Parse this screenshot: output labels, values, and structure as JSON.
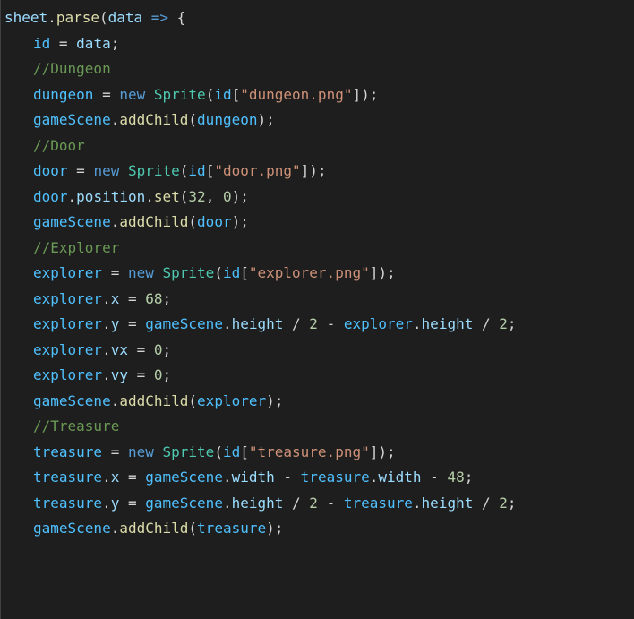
{
  "code": {
    "l1": {
      "obj": "sheet",
      "d1": ".",
      "fn": "parse",
      "p1": "(",
      "arg": "data",
      "arrow": " => ",
      "b1": "{"
    },
    "l2": {
      "v": "id",
      "eq": " = ",
      "rhs": "data",
      "sc": ";"
    },
    "l3": {
      "cmt": "//Dungeon"
    },
    "l4": {
      "v": "dungeon",
      "eq": " = ",
      "kw": "new",
      "sp": " ",
      "cls": "Sprite",
      "p1": "(",
      "v2": "id",
      "br1": "[",
      "s": "\"dungeon.png\"",
      "br2": "]);"
    },
    "l5": {
      "v": "gameScene",
      "d": ".",
      "fn": "addChild",
      "p1": "(",
      "arg": "dungeon",
      "p2": ");"
    },
    "l6": {
      "blank": ""
    },
    "l7": {
      "cmt": "//Door"
    },
    "l8": {
      "v": "door",
      "eq": " = ",
      "kw": "new",
      "sp": " ",
      "cls": "Sprite",
      "p1": "(",
      "v2": "id",
      "br1": "[",
      "s": "\"door.png\"",
      "br2": "]);"
    },
    "l9": {
      "v": "door",
      "d": ".",
      "p": "position",
      "d2": ".",
      "fn": "set",
      "p1": "(",
      "n1": "32",
      "c": ", ",
      "n2": "0",
      "p2": ");"
    },
    "l10": {
      "v": "gameScene",
      "d": ".",
      "fn": "addChild",
      "p1": "(",
      "arg": "door",
      "p2": ");"
    },
    "l11": {
      "blank": ""
    },
    "l12": {
      "cmt": "//Explorer"
    },
    "l13": {
      "v": "explorer",
      "eq": " = ",
      "kw": "new",
      "sp": " ",
      "cls": "Sprite",
      "p1": "(",
      "v2": "id",
      "br1": "[",
      "s": "\"explorer.png\"",
      "br2": "]);"
    },
    "l14": {
      "v": "explorer",
      "d": ".",
      "p": "x",
      "eq": " = ",
      "n": "68",
      "sc": ";"
    },
    "l15": {
      "v": "explorer",
      "d": ".",
      "p": "y",
      "eq": " = ",
      "v2": "gameScene",
      "d2": ".",
      "p2": "height",
      "op": " / ",
      "n": "2",
      "op2": " - ",
      "v3": "explorer",
      "d3": ".",
      "p3": "height",
      "op3": " / ",
      "n2": "2",
      "sc": ";"
    },
    "l16": {
      "v": "explorer",
      "d": ".",
      "p": "vx",
      "eq": " = ",
      "n": "0",
      "sc": ";"
    },
    "l17": {
      "v": "explorer",
      "d": ".",
      "p": "vy",
      "eq": " = ",
      "n": "0",
      "sc": ";"
    },
    "l18": {
      "v": "gameScene",
      "d": ".",
      "fn": "addChild",
      "p1": "(",
      "arg": "explorer",
      "p2": ");"
    },
    "l19": {
      "blank": ""
    },
    "l20": {
      "cmt": "//Treasure"
    },
    "l21": {
      "v": "treasure",
      "eq": " = ",
      "kw": "new",
      "sp": " ",
      "cls": "Sprite",
      "p1": "(",
      "v2": "id",
      "br1": "[",
      "s": "\"treasure.png\"",
      "br2": "]);"
    },
    "l22": {
      "v": "treasure",
      "d": ".",
      "p": "x",
      "eq": " = ",
      "v2": "gameScene",
      "d2": ".",
      "p2": "width",
      "op": " - ",
      "v3": "treasure",
      "d3": ".",
      "p3": "width",
      "op2": " - ",
      "n": "48",
      "sc": ";"
    },
    "l23": {
      "v": "treasure",
      "d": ".",
      "p": "y",
      "eq": " = ",
      "v2": "gameScene",
      "d2": ".",
      "p2": "height",
      "op": " / ",
      "n": "2",
      "op2": " - ",
      "v3": "treasure",
      "d3": ".",
      "p3": "height",
      "op3": " / ",
      "n2": "2",
      "sc": ";"
    },
    "l24": {
      "v": "gameScene",
      "d": ".",
      "fn": "addChild",
      "p1": "(",
      "arg": "treasure",
      "p2": ");"
    }
  }
}
